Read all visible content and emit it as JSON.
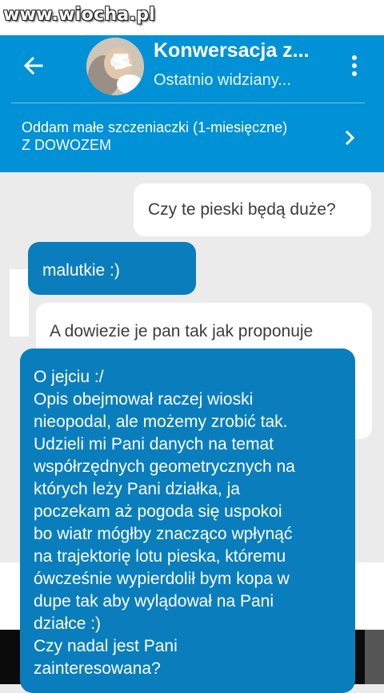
{
  "watermark": "www.wiocha.pl",
  "header": {
    "title": "Konwersacja z...",
    "subtitle": "Ostatnio widziany...",
    "listing_line1": "Oddam małe szczeniaczki (1-miesięczne)",
    "listing_line2": "Z DOWOZEM"
  },
  "messages": [
    {
      "direction": "outgoing",
      "text": "Czy te pieski będą duże?"
    },
    {
      "direction": "incoming",
      "text": "malutkie :)"
    },
    {
      "direction": "outgoing",
      "text": "A dowiezie je pan tak jak proponuje"
    },
    {
      "direction": "incoming",
      "lines": [
        "O jejciu :/",
        "Opis obejmował raczej wioski",
        "nieopodal, ale możemy zrobić tak.",
        "Udzieli mi Pani danych na temat",
        "współrzędnych geometrycznych na",
        "których leży Pani działka, ja",
        "poczekam aż pogoda się uspokoi",
        "bo wiatr mógłby znacząco wpłynąć",
        "na trajektorię lotu pieska, któremu",
        "ówcześnie wypierdolił bym kopa w",
        "dupe tak aby wylądował na Pani",
        "działce :)",
        "Czy nadal jest Pani",
        "zainteresowana?"
      ]
    }
  ],
  "colors": {
    "header": "#0091d6",
    "incoming_bubble": "#0a7ebd",
    "outgoing_bubble": "#ffffff",
    "chat_background": "#ebebeb"
  }
}
